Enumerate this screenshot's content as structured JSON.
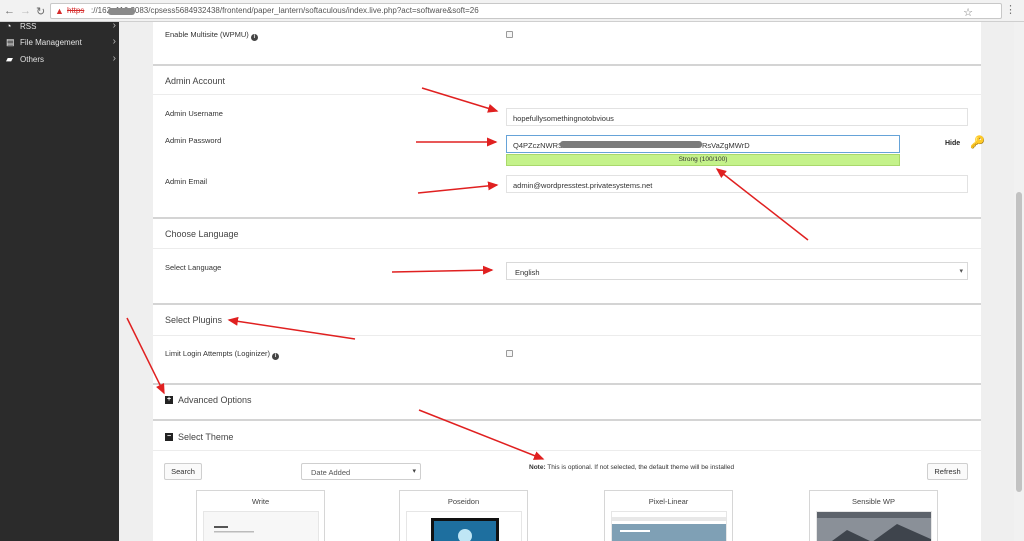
{
  "browser": {
    "url_scheme": "https",
    "url_rest": "://162        .116:2083/cpsess5684932438/frontend/paper_lantern/softaculous/index.live.php?act=software&soft=26",
    "back_icon": "arrow-left-icon",
    "forward_icon": "arrow-right-icon",
    "reload_icon": "reload-icon",
    "bookmark_icon": "star-icon",
    "menu_icon": "kebab-menu-icon"
  },
  "sidebar": {
    "items": [
      {
        "label": "RSS",
        "icon": "rss-icon"
      },
      {
        "label": "File Management",
        "icon": "file-icon"
      },
      {
        "label": "Others",
        "icon": "folder-icon"
      }
    ]
  },
  "form": {
    "multisite_label": "Enable Multisite (WPMU)",
    "admin_account_title": "Admin Account",
    "admin_username_label": "Admin Username",
    "admin_username_value": "hopefullysomethingnotobvious",
    "admin_password_label": "Admin Password",
    "admin_password_prefix": "Q4PZczNWRS",
    "admin_password_suffix": "RsVaZgMWrD",
    "password_strength": "Strong (100/100)",
    "hide_label": "Hide",
    "admin_email_label": "Admin Email",
    "admin_email_value": "admin@wordpresstest.privatesystems.net",
    "choose_language_title": "Choose Language",
    "select_language_label": "Select Language",
    "language_value": "English",
    "select_plugins_title": "Select Plugins",
    "limit_login_label": "Limit Login Attempts (Loginizer)",
    "advanced_options_title": "Advanced Options",
    "select_theme_title": "Select Theme",
    "search_button": "Search",
    "sort_value": "Date Added",
    "note_label": "Note:",
    "note_text": " This is optional. If not selected, the default theme will be installed",
    "refresh_button": "Refresh"
  },
  "themes": [
    {
      "name": "Write"
    },
    {
      "name": "Poseidon"
    },
    {
      "name": "Pixel-Linear"
    },
    {
      "name": "Sensible WP"
    }
  ],
  "colors": {
    "strength_bar": "#c4f28a",
    "annotation_arrow": "#e02020",
    "key_icon": "#e0a81a"
  }
}
